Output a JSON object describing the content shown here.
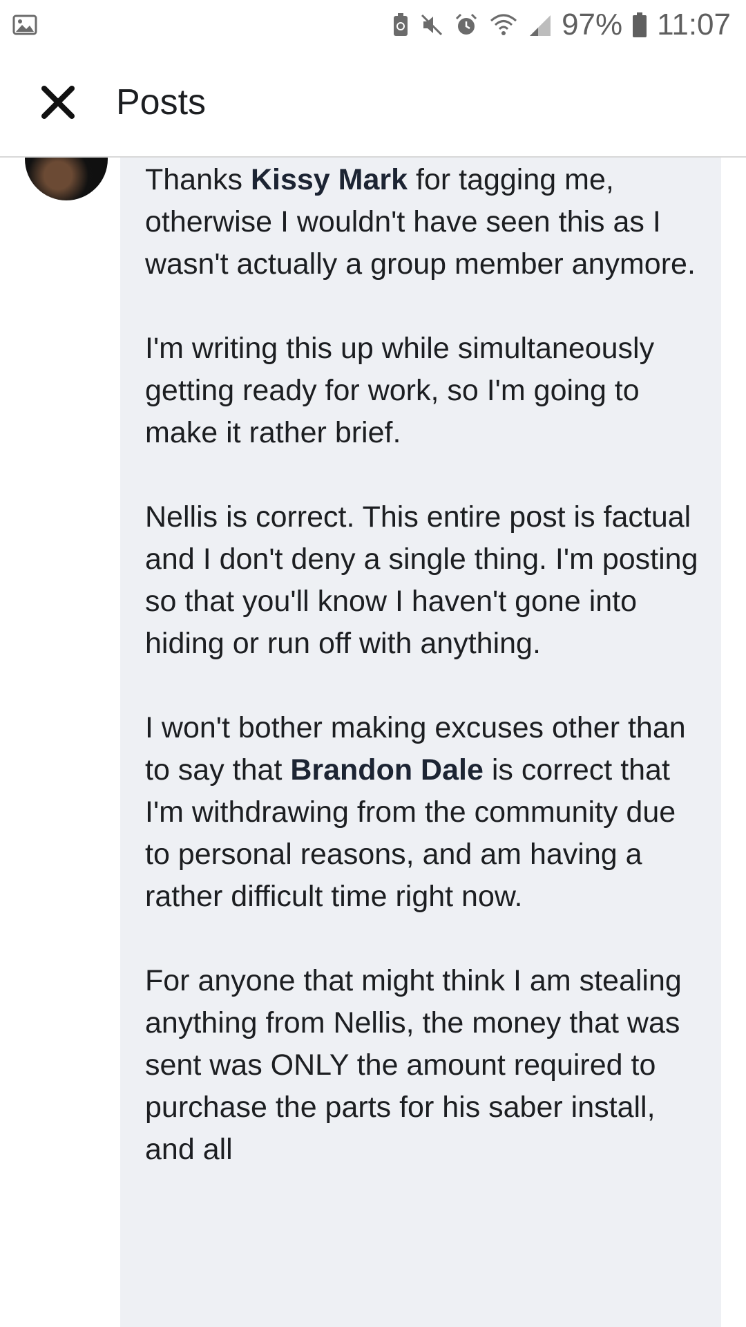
{
  "status_bar": {
    "battery_percent": "97%",
    "time": "11:07",
    "icons": [
      "image-icon",
      "battery-saver-icon",
      "mute-icon",
      "alarm-icon",
      "wifi-icon",
      "signal-icon",
      "battery-icon"
    ]
  },
  "header": {
    "close_icon": "close-icon",
    "title": "Posts"
  },
  "comment": {
    "p1_before": "Thanks ",
    "p1_mention": "Kissy Mark",
    "p1_after": " for tagging me, otherwise I wouldn't have seen this as I wasn't actually a group member anymore.",
    "p2": "I'm writing this up while simultaneously getting ready for work, so I'm going to make it rather brief.",
    "p3": "Nellis is correct. This entire post is factual and I don't deny a single thing. I'm posting so that you'll know I haven't gone into hiding or run off with anything.",
    "p4_before": "I won't bother making excuses other than to say that ",
    "p4_mention": "Brandon Dale",
    "p4_after": " is correct that I'm withdrawing from the community due to personal reasons, and am having a rather difficult time right now.",
    "p5": "For anyone that might think I am stealing anything from Nellis, the money that was sent was ONLY the amount required to purchase the parts for his saber install, and all"
  },
  "colors": {
    "bubble_bg": "#eef0f4",
    "text": "#1c1e21",
    "divider": "#d8d8d8"
  }
}
